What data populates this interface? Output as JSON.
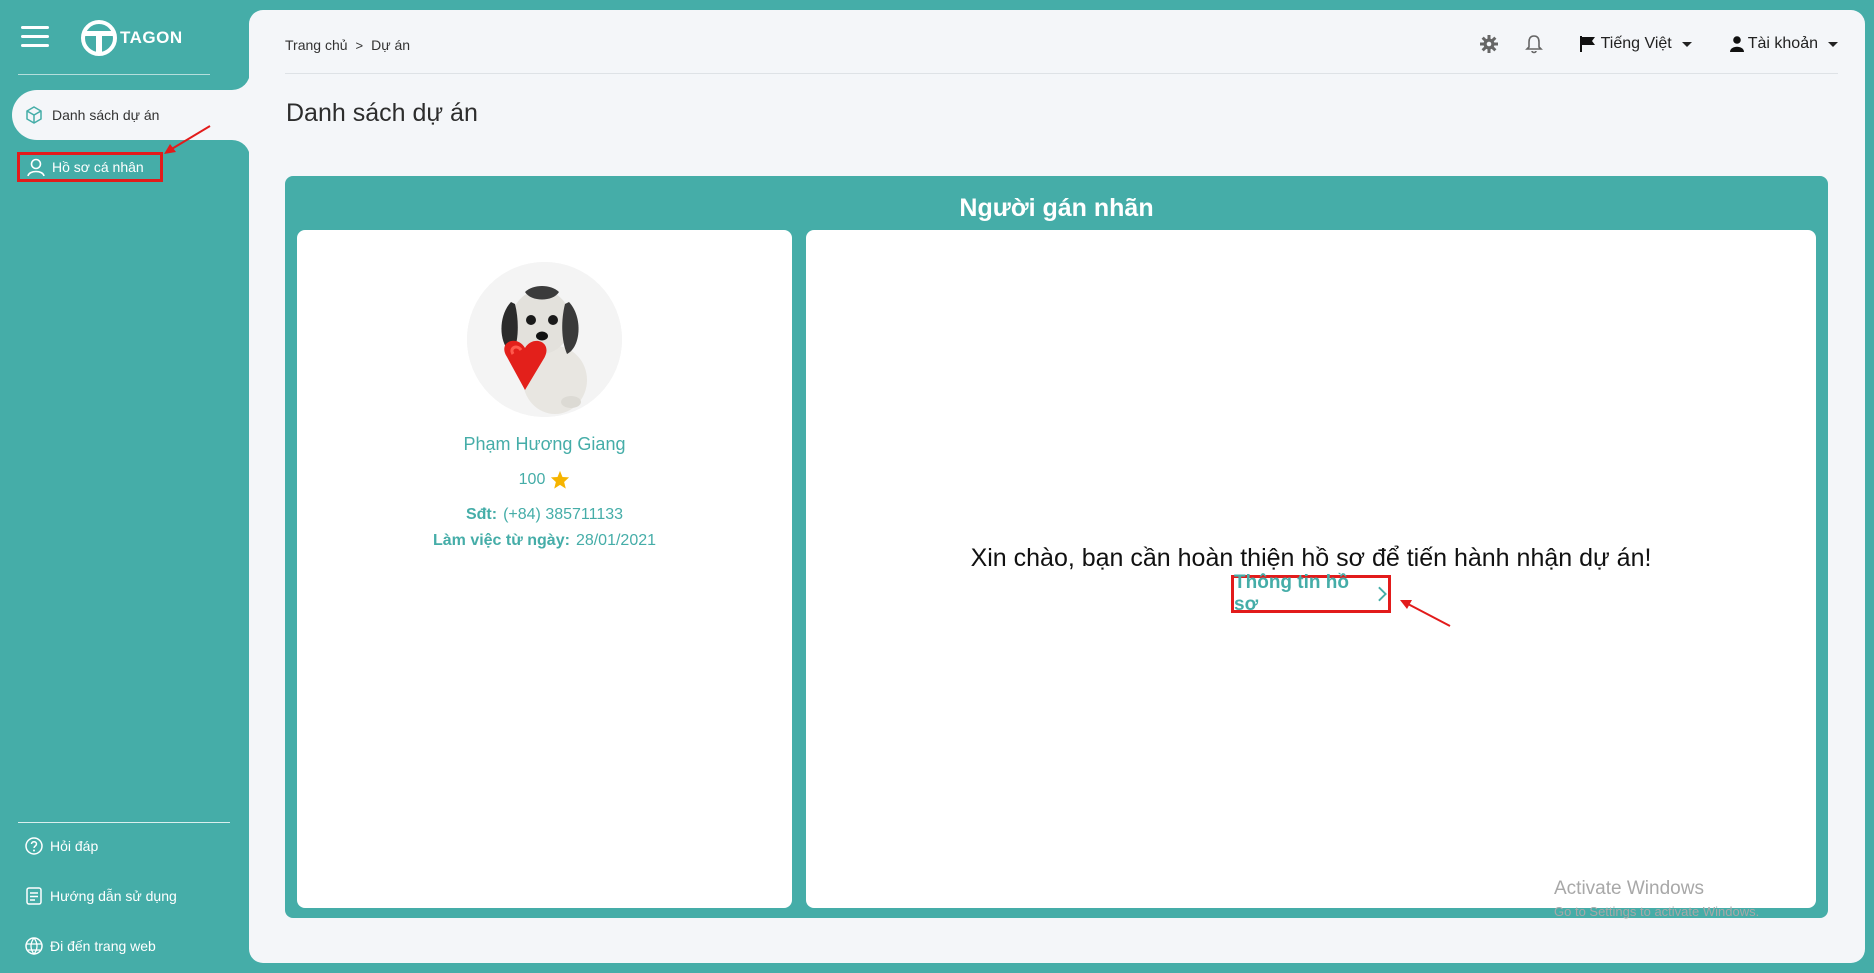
{
  "app": {
    "logo_text": "TAGON"
  },
  "sidebar": {
    "items": [
      {
        "label": "Danh sách dự án",
        "icon": "cube-icon",
        "active": true
      },
      {
        "label": "Hồ sơ cá nhân",
        "icon": "user-icon",
        "active": false
      }
    ],
    "footer": [
      {
        "label": "Hỏi đáp",
        "icon": "question-circle-icon"
      },
      {
        "label": "Hướng dẫn sử dụng",
        "icon": "document-icon"
      },
      {
        "label": "Đi đến trang web",
        "icon": "globe-icon"
      }
    ]
  },
  "header": {
    "breadcrumb": [
      "Trang chủ",
      "Dự án"
    ],
    "language": "Tiếng Việt",
    "account": "Tài khoản"
  },
  "page": {
    "title": "Danh sách dự án"
  },
  "card": {
    "title": "Người gán nhãn",
    "profile": {
      "name": "Phạm Hương Giang",
      "score": "100",
      "phone_label": "Sđt:",
      "phone": "(+84) 385711133",
      "since_label": "Làm việc từ ngày:",
      "since": "28/01/2021"
    },
    "welcome": {
      "message": "Xin chào, bạn cần hoàn thiện hồ sơ để tiến hành nhận dự án!",
      "link": "Thông tin hồ sơ"
    }
  },
  "watermark": {
    "line1": "Activate Windows",
    "line2": "Go to Settings to activate Windows."
  },
  "colors": {
    "primary": "#45ada8",
    "background": "#f4f6f9",
    "highlight": "#e21b1b",
    "star": "#f6b400"
  }
}
